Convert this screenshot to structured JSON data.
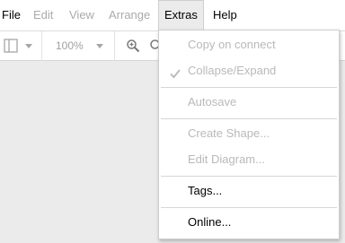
{
  "menubar": {
    "items": [
      {
        "label": "File",
        "state": "enabled"
      },
      {
        "label": "Edit",
        "state": "disabled"
      },
      {
        "label": "View",
        "state": "disabled"
      },
      {
        "label": "Arrange",
        "state": "disabled"
      },
      {
        "label": "Extras",
        "state": "open"
      },
      {
        "label": "Help",
        "state": "enabled"
      }
    ]
  },
  "toolbar": {
    "zoom_value": "100%",
    "icons": [
      "page-view-icon",
      "zoom-in-icon",
      "zoom-out-icon"
    ]
  },
  "extras_menu": {
    "copy_on_connect": "Copy on connect",
    "collapse_expand": "Collapse/Expand",
    "autosave": "Autosave",
    "create_shape": "Create Shape...",
    "edit_diagram": "Edit Diagram...",
    "tags": "Tags...",
    "online": "Online..."
  },
  "colors": {
    "disabled_text": "#b9b9b9",
    "canvas_bg": "#ebebeb",
    "menu_bg": "#ffffff"
  }
}
